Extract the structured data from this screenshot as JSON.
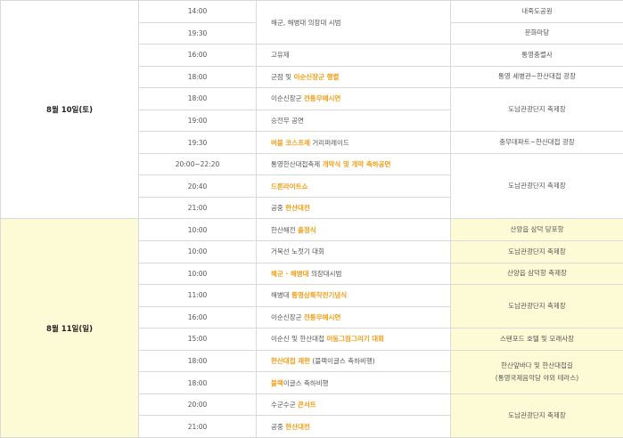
{
  "days": [
    {
      "date": "8월 10일(토)",
      "rows": [
        {
          "time": "14:00",
          "event": [
            {
              "t": "해군, 해병대 의장대 시범",
              "hl": false
            }
          ],
          "venue": "내죽도공원"
        },
        {
          "time": "19:30",
          "event": [],
          "venue": "문화마당"
        },
        {
          "time": "16:00",
          "event": [
            {
              "t": "고유제",
              "hl": false
            }
          ],
          "venue": "통영충렬사"
        },
        {
          "time": "18:00",
          "event": [
            {
              "t": "군점 및 ",
              "hl": false
            },
            {
              "t": "이순신장군 행렬",
              "hl": true
            }
          ],
          "venue": "통영 세병관~한산대첩 광장"
        },
        {
          "time": "18:00",
          "event": [
            {
              "t": "이순신장군 ",
              "hl": false
            },
            {
              "t": "전통무예시연",
              "hl": true
            }
          ],
          "venue": "도남관광단지 축제장"
        },
        {
          "time": "19:00",
          "event": [
            {
              "t": "승전무 공연",
              "hl": false
            }
          ],
          "venue": ""
        },
        {
          "time": "19:30",
          "event": [
            {
              "t": "버블 코스프레",
              "hl": true
            },
            {
              "t": " 거리퍼레이드",
              "hl": false
            }
          ],
          "venue": "충무데파트~한산대첩 광장"
        },
        {
          "time": "20:00~22:20",
          "event": [
            {
              "t": "통영한산대첩축제 ",
              "hl": false
            },
            {
              "t": "개막식 및 개막 축하공연",
              "hl": true
            }
          ],
          "venue": "도남관광단지 축제장"
        },
        {
          "time": "20:40",
          "event": [
            {
              "t": "드론라이트쇼",
              "hl": true
            }
          ],
          "venue": ""
        },
        {
          "time": "21:00",
          "event": [
            {
              "t": "공중 ",
              "hl": false
            },
            {
              "t": "한산대전",
              "hl": true
            }
          ],
          "venue": ""
        }
      ]
    },
    {
      "date": "8월 11일(일)",
      "rows": [
        {
          "time": "10:00",
          "event": [
            {
              "t": "한산해전 ",
              "hl": false
            },
            {
              "t": "출정식",
              "hl": true
            }
          ],
          "venue": "산양읍 삼덕 당포항"
        },
        {
          "time": "10:00",
          "event": [
            {
              "t": "거북선 노젓기 대회",
              "hl": false
            }
          ],
          "venue": "도남관광단지 축제장"
        },
        {
          "time": "10:00",
          "event": [
            {
              "t": "해군 · 해병대",
              "hl": true
            },
            {
              "t": " 의장대시범",
              "hl": false
            }
          ],
          "venue": "산양읍 삼덕항 축제장"
        },
        {
          "time": "11:00",
          "event": [
            {
              "t": "해병대 ",
              "hl": false
            },
            {
              "t": "통영상륙작전기념식",
              "hl": true
            }
          ],
          "venue": "도남관광단지 축제장"
        },
        {
          "time": "16:00",
          "event": [
            {
              "t": "이순신장군 ",
              "hl": false
            },
            {
              "t": "전통무예시연",
              "hl": true
            }
          ],
          "venue": ""
        },
        {
          "time": "15:00",
          "event": [
            {
              "t": "이순신 및 한산대첩 ",
              "hl": false
            },
            {
              "t": "어동그림그리기 대회",
              "hl": true
            }
          ],
          "venue": "스탠포드 호텔 및 모래사장"
        },
        {
          "time": "18:00",
          "event": [
            {
              "t": "한산대첩 재현",
              "hl": true
            },
            {
              "t": " (블랙이글스 축하비행)",
              "hl": false
            }
          ],
          "venue": "한산앞바다 및 한산대첩길"
        },
        {
          "time": "18:00",
          "event": [
            {
              "t": "블랙",
              "hl": true
            },
            {
              "t": "이글스 축하비행",
              "hl": false
            }
          ],
          "venue": "(통영국제음악당 야외 테라스)"
        },
        {
          "time": "20:00",
          "event": [
            {
              "t": "수군수군 ",
              "hl": false
            },
            {
              "t": "콘서트",
              "hl": true
            }
          ],
          "venue": "도남관광단지 축제장"
        },
        {
          "time": "21:00",
          "event": [
            {
              "t": "공중 ",
              "hl": false
            },
            {
              "t": "한산대전",
              "hl": true
            }
          ],
          "venue": ""
        }
      ]
    }
  ]
}
